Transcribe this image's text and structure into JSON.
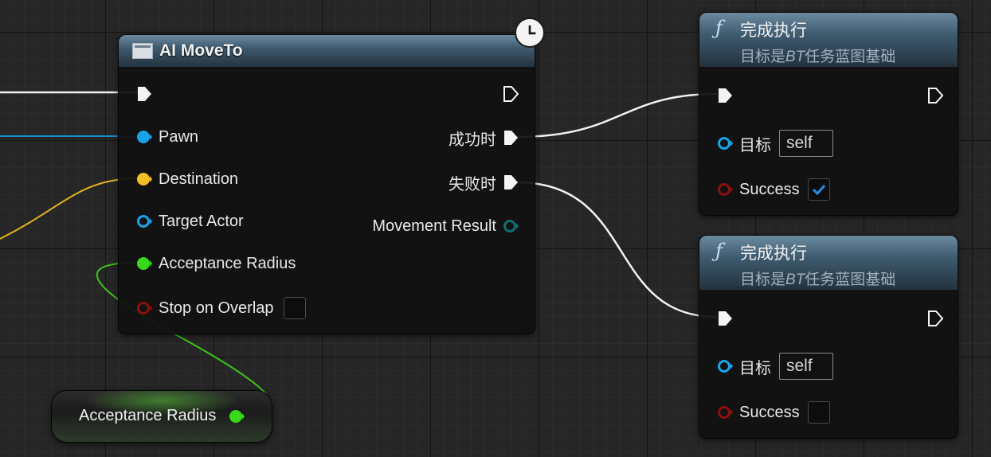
{
  "moveto_node": {
    "title": "AI MoveTo",
    "inputs": {
      "pawn": "Pawn",
      "destination": "Destination",
      "target_actor": "Target Actor",
      "acceptance_radius": "Acceptance Radius",
      "stop_on_overlap": "Stop on Overlap"
    },
    "outputs": {
      "on_success": "成功时",
      "on_fail": "失败时",
      "movement_result": "Movement Result"
    },
    "stop_on_overlap_checked": false
  },
  "finish_node_top": {
    "title": "完成执行",
    "subtitle_prefix": "目标是",
    "subtitle_italic": "BT",
    "subtitle_suffix": "任务蓝图基础",
    "target_label": "目标",
    "target_value": "self",
    "success_label": "Success",
    "success_checked": true
  },
  "finish_node_bottom": {
    "title": "完成执行",
    "subtitle_prefix": "目标是",
    "subtitle_italic": "BT",
    "subtitle_suffix": "任务蓝图基础",
    "target_label": "目标",
    "target_value": "self",
    "success_label": "Success",
    "success_checked": false
  },
  "variable_node": {
    "label": "Acceptance Radius"
  },
  "icons": {
    "function": "function-icon",
    "header": "blueprint-node-icon",
    "latent": "clock-icon",
    "exec_pin": "exec-pin-icon",
    "data_pin": "data-pin-icon",
    "checkmark": "checkmark-icon"
  },
  "colors": {
    "exec_wire": "#ffffff",
    "object_pin": "#1aa3e8",
    "vector_pin": "#f2c025",
    "float_pin": "#38d81b",
    "bool_pin": "#8c0f0f",
    "struct_pin": "#0f6f6f",
    "check_blue": "#1f8fe8"
  }
}
